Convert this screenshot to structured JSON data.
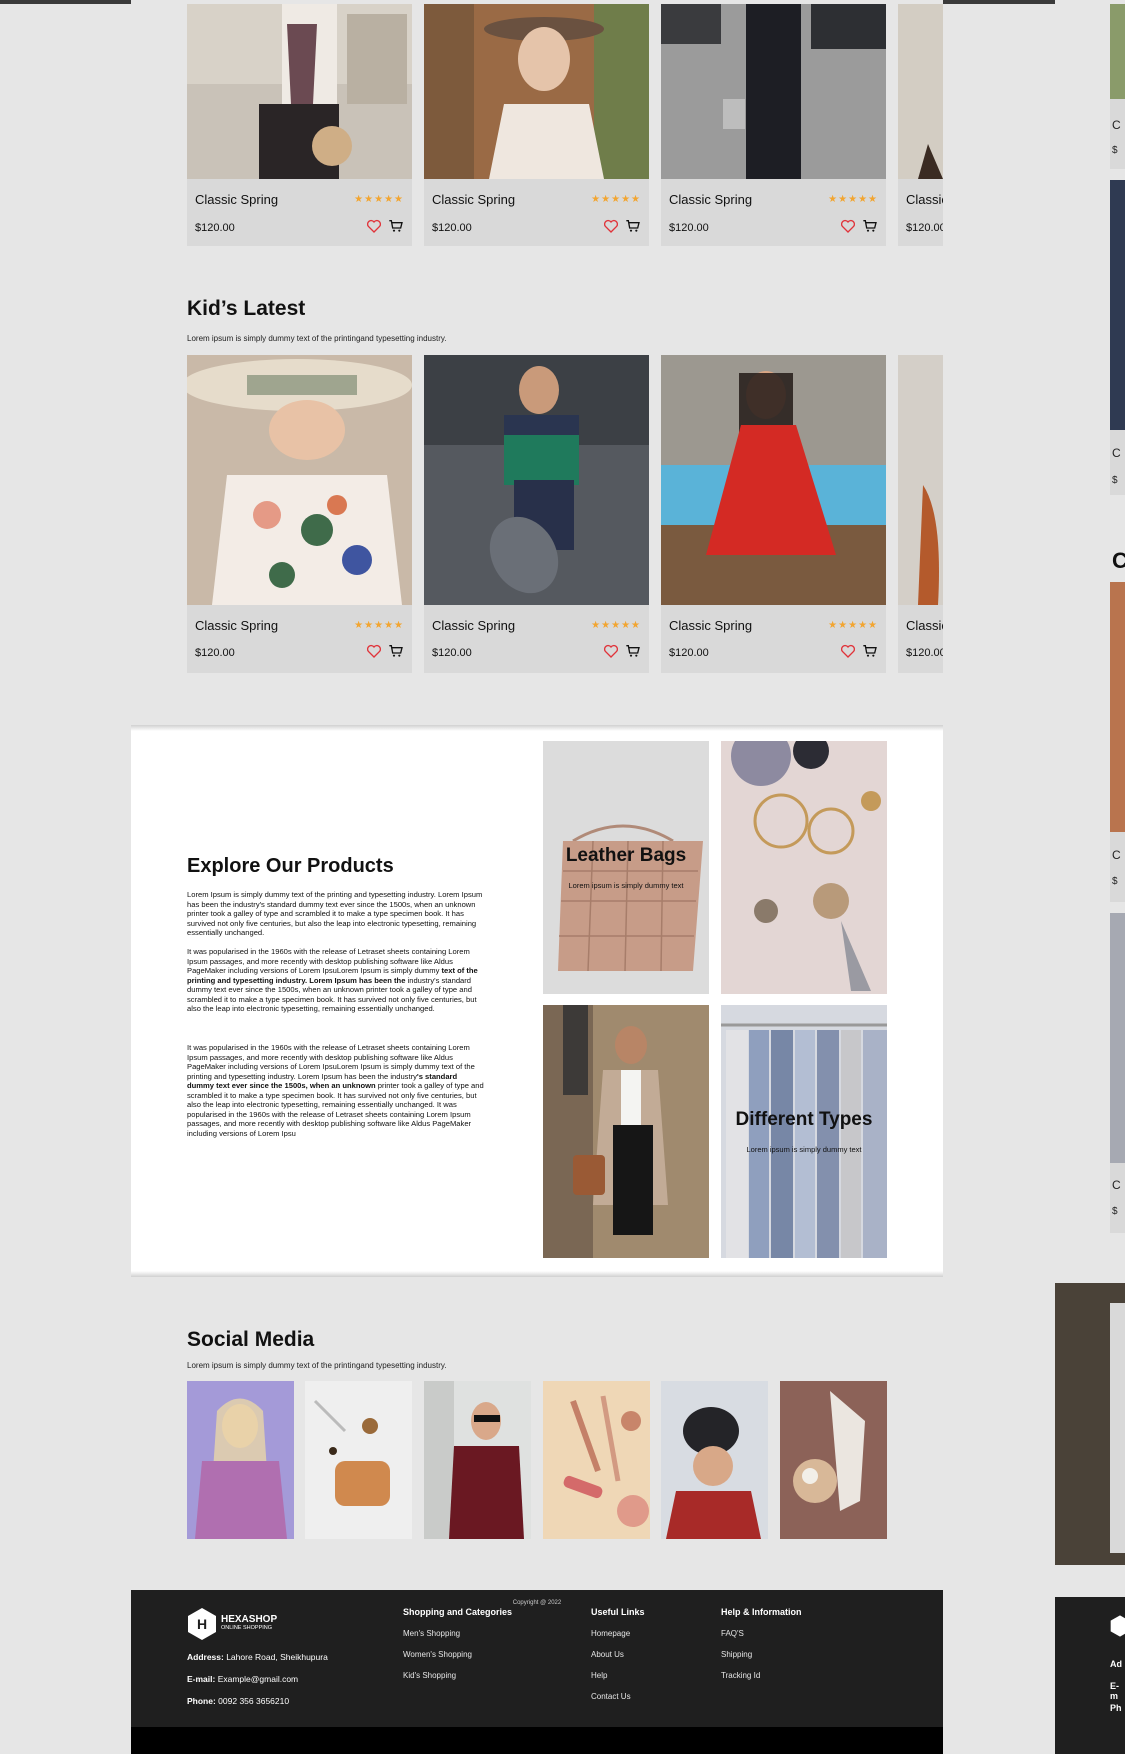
{
  "colors": {
    "star": "#f2a531",
    "footer_bg": "#1f1f1f",
    "card_bg": "#d9d9d9",
    "heart": "#e0333a"
  },
  "women_row": {
    "cards": [
      {
        "name": "Classic Spring",
        "stars": "★★★★★",
        "price": "$120.00"
      },
      {
        "name": "Classic Spring",
        "stars": "★★★★★",
        "price": "$120.00"
      },
      {
        "name": "Classic Spring",
        "stars": "★★★★★",
        "price": "$120.00"
      },
      {
        "name": "Classic Spring",
        "stars": "★★★★★",
        "price": "$120.00"
      }
    ]
  },
  "kids": {
    "title": "Kid’s Latest",
    "subtitle": "Lorem ipsum is simply dummy text of the printingand typesetting industry.",
    "cards": [
      {
        "name": "Classic Spring",
        "stars": "★★★★★",
        "price": "$120.00"
      },
      {
        "name": "Classic Spring",
        "stars": "★★★★★",
        "price": "$120.00"
      },
      {
        "name": "Classic Spring",
        "stars": "★★★★★",
        "price": "$120.00"
      },
      {
        "name": "Classic Spring",
        "stars": "★★★★★",
        "price": "$120.00"
      }
    ]
  },
  "explore": {
    "title": "Explore Our Products",
    "para1": "Lorem Ipsum is simply dummy text of the printing and typesetting industry. Lorem Ipsum has been the industry's standard dummy text ever since the 1500s, when an unknown printer took a galley of type and scrambled it to make a type specimen book. It has survived not only five centuries, but also the leap into electronic typesetting, remaining essentially unchanged.",
    "para2_a": " It was popularised in the 1960s with the release of Letraset sheets containing Lorem Ipsum passages, and more recently with desktop publishing software like Aldus PageMaker including versions of Lorem IpsuLorem Ipsum is simply dummy ",
    "para2_b": "text of the printing and typesetting industry. Lorem Ipsum has been the",
    "para2_c": " industry's standard dummy text ever since the 1500s, when an unknown printer took a galley of type and scrambled it to make a type specimen book. It has survived not only five centuries, but also the leap into electronic typesetting, remaining essentially unchanged.",
    "para3_a": " It was popularised in the 1960s with the release of Letraset sheets containing Lorem Ipsum passages, and more recently with desktop publishing software like Aldus PageMaker including versions of Lorem IpsuLorem Ipsum is simply dummy text of the printing and typesetting industry. Lorem Ipsum has been the industry",
    "para3_b": "'s standard dummy text ever since the 1500s, when an unknown",
    "para3_c": " printer took a galley of type and scrambled it to make a type specimen book. It has survived not only five centuries, but also the leap into electronic typesetting, remaining essentially unchanged. It was popularised in the 1960s with the release of Letraset sheets containing Lorem Ipsum passages, and more recently with desktop publishing software like Aldus PageMaker including versions of Lorem Ipsu",
    "tile1_title": "Leather Bags",
    "tile1_sub": "Lorem ipsum is simply dummy text",
    "tile4_title": "Different Types",
    "tile4_sub": "Lorem ipsum is simply dummy text"
  },
  "social": {
    "title": "Social Media",
    "subtitle": "Lorem ipsum is simply dummy text of the printingand typesetting industry."
  },
  "footer": {
    "logo_letter": "H",
    "brand": "HEXASHOP",
    "brand_sub": "ONLINE SHOPPING",
    "address_label": "Address:",
    "address": " Lahore Road, Sheikhupura",
    "email_label": "E-mail:",
    "email": " Example@gmail.com",
    "phone_label": "Phone:",
    "phone": " 0092 356 3656210",
    "col1_title": "Shopping and Categories",
    "col1_links": [
      "Men's Shopping",
      "Women's Shopping",
      "Kid's Shopping"
    ],
    "col2_title": "Useful Links",
    "col2_links": [
      "Homepage",
      "About Us",
      "Help",
      "Contact Us"
    ],
    "col3_title": "Help & Information",
    "col3_links": [
      "FAQ'S",
      "Shipping",
      "Tracking Id"
    ],
    "copyright": "Copyright @ 2022"
  },
  "side": {
    "letters": [
      "C",
      "$",
      "C",
      "$",
      "C",
      "C",
      "$",
      "C",
      "$"
    ],
    "footer_labels": [
      "Ad",
      "E-m",
      "Ph"
    ]
  }
}
